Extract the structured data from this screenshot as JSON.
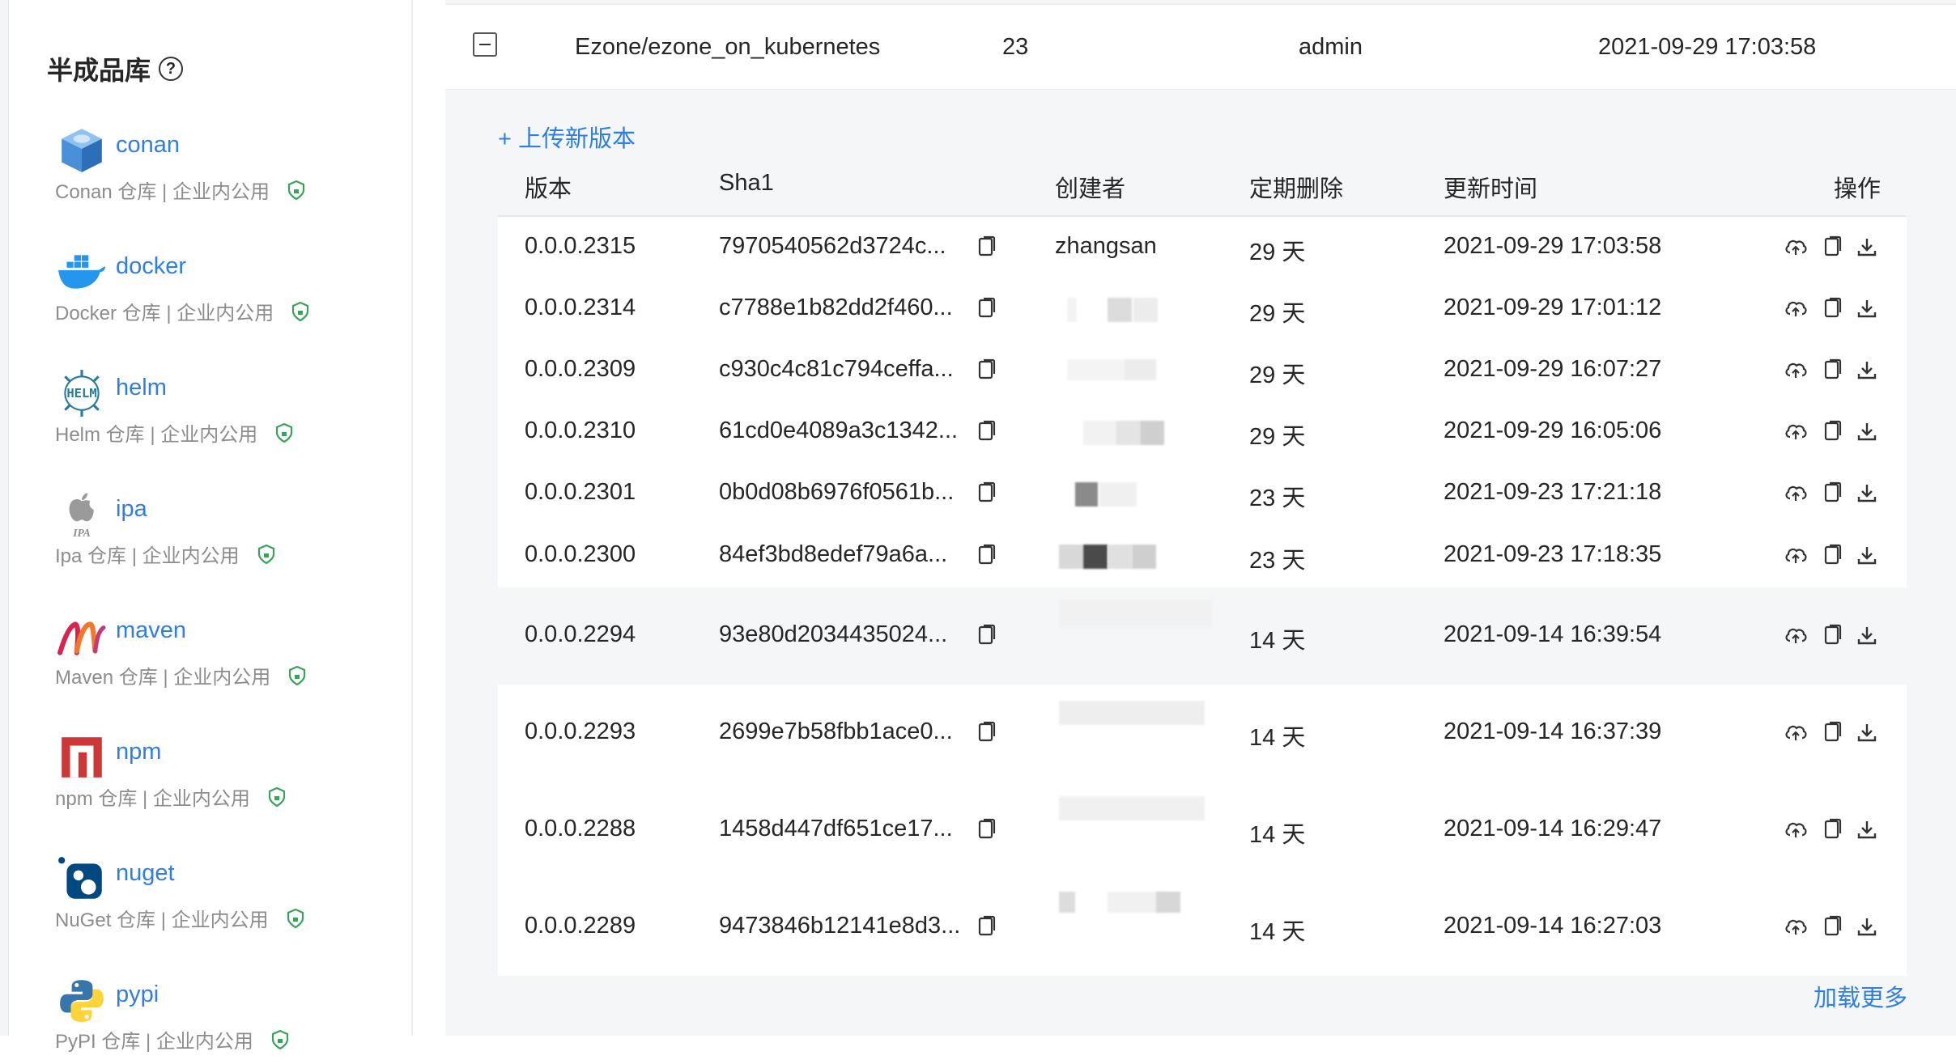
{
  "sidebar": {
    "title": "半成品库",
    "repos": [
      {
        "name": "conan",
        "desc": "Conan 仓库 | 企业内公用",
        "icon": "conan-cube-icon"
      },
      {
        "name": "docker",
        "desc": "Docker 仓库 | 企业内公用",
        "icon": "docker-whale-icon"
      },
      {
        "name": "helm",
        "desc": "Helm 仓库 | 企业内公用",
        "icon": "helm-wheel-icon"
      },
      {
        "name": "ipa",
        "desc": "Ipa 仓库 | 企业内公用",
        "icon": "apple-ipa-icon"
      },
      {
        "name": "maven",
        "desc": "Maven 仓库 | 企业内公用",
        "icon": "maven-feather-icon"
      },
      {
        "name": "npm",
        "desc": "npm 仓库 | 企业内公用",
        "icon": "npm-icon"
      },
      {
        "name": "nuget",
        "desc": "NuGet 仓库 | 企业内公用",
        "icon": "nuget-icon"
      },
      {
        "name": "pypi",
        "desc": "PyPI 仓库 | 企业内公用",
        "icon": "python-icon"
      }
    ]
  },
  "parent_row": {
    "path": "Ezone/ezone_on_kubernetes",
    "count": "23",
    "creator": "admin",
    "time": "2021-09-29 17:03:58"
  },
  "upload_label": "+ 上传新版本",
  "table": {
    "headers": {
      "version": "版本",
      "sha1": "Sha1",
      "creator": "创建者",
      "expire": "定期删除",
      "updated": "更新时间",
      "actions": "操作"
    },
    "rows": [
      {
        "version": "0.0.0.2315",
        "sha1": "7970540562d3724c...",
        "creator": "zhangsan",
        "expire": "29 天",
        "updated": "2021-09-29 17:03:58"
      },
      {
        "version": "0.0.0.2314",
        "sha1": "c7788e1b82dd2f460...",
        "creator": "",
        "expire": "29 天",
        "updated": "2021-09-29 17:01:12"
      },
      {
        "version": "0.0.0.2309",
        "sha1": "c930c4c81c794ceffa...",
        "creator": "",
        "expire": "29 天",
        "updated": "2021-09-29 16:07:27"
      },
      {
        "version": "0.0.0.2310",
        "sha1": "61cd0e4089a3c1342...",
        "creator": "",
        "expire": "29 天",
        "updated": "2021-09-29 16:05:06"
      },
      {
        "version": "0.0.0.2301",
        "sha1": "0b0d08b6976f0561b...",
        "creator": "",
        "expire": "23 天",
        "updated": "2021-09-23 17:21:18"
      },
      {
        "version": "0.0.0.2300",
        "sha1": "84ef3bd8edef79a6a...",
        "creator": "",
        "expire": "23 天",
        "updated": "2021-09-23 17:18:35"
      },
      {
        "version": "0.0.0.2294",
        "sha1": "93e80d2034435024...",
        "creator": "",
        "expire": "14 天",
        "updated": "2021-09-14 16:39:54"
      },
      {
        "version": "0.0.0.2293",
        "sha1": "2699e7b58fbb1ace0...",
        "creator": "",
        "expire": "14 天",
        "updated": "2021-09-14 16:37:39"
      },
      {
        "version": "0.0.0.2288",
        "sha1": "1458d447df651ce17...",
        "creator": "",
        "expire": "14 天",
        "updated": "2021-09-14 16:29:47"
      },
      {
        "version": "0.0.0.2289",
        "sha1": "9473846b12141e8d3...",
        "creator": "",
        "expire": "14 天",
        "updated": "2021-09-14 16:27:03"
      }
    ]
  },
  "load_more": "加载更多",
  "colors": {
    "accent": "#2e7ee6",
    "muted": "#8c8c8c",
    "panel": "#f5f6f8",
    "shield": "#3aa35b"
  }
}
